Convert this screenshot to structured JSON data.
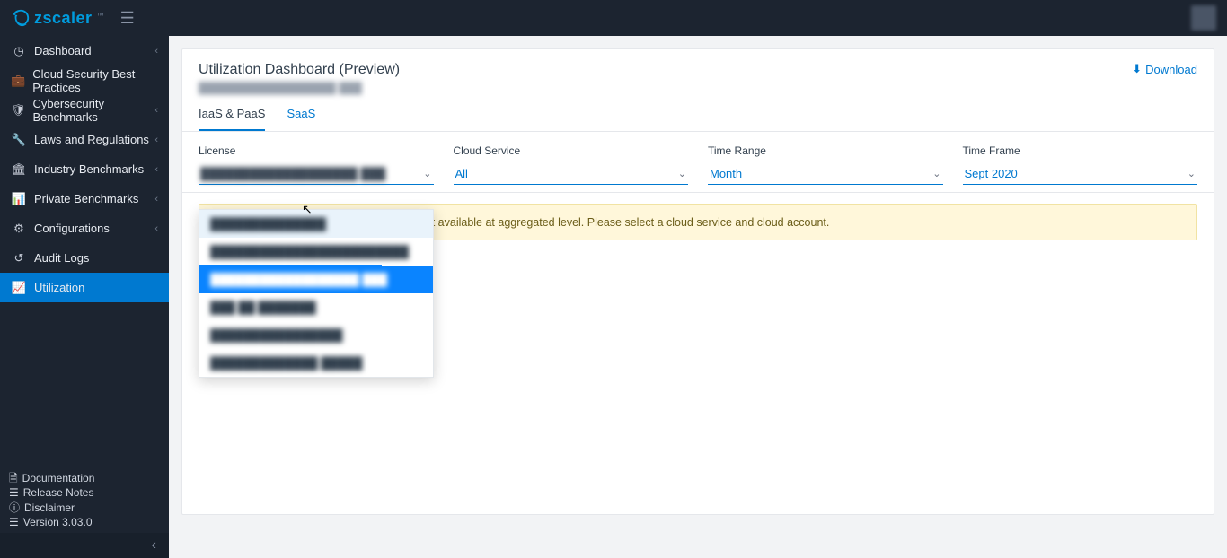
{
  "brand": {
    "name": "zscaler"
  },
  "sidebar": {
    "items": [
      {
        "label": "Dashboard",
        "icon": "gauge",
        "expandable": true
      },
      {
        "label": "Cloud Security Best Practices",
        "icon": "briefcase",
        "expandable": false
      },
      {
        "label": "Cybersecurity Benchmarks",
        "icon": "shield",
        "expandable": true
      },
      {
        "label": "Laws and Regulations",
        "icon": "wrench",
        "expandable": true
      },
      {
        "label": "Industry Benchmarks",
        "icon": "bank",
        "expandable": true
      },
      {
        "label": "Private Benchmarks",
        "icon": "bars",
        "expandable": true
      },
      {
        "label": "Configurations",
        "icon": "sliders",
        "expandable": true
      },
      {
        "label": "Audit Logs",
        "icon": "history",
        "expandable": false
      },
      {
        "label": "Utilization",
        "icon": "line-chart",
        "expandable": false
      }
    ],
    "footer": [
      {
        "label": "Documentation",
        "icon": "doc"
      },
      {
        "label": "Release Notes",
        "icon": "list"
      },
      {
        "label": "Disclaimer",
        "icon": "info"
      },
      {
        "label": "Version 3.03.0",
        "icon": "list"
      }
    ]
  },
  "page": {
    "title": "Utilization Dashboard (Preview)",
    "subtitle": "██████████████████  ███",
    "download": "Download"
  },
  "tabs": [
    {
      "label": "IaaS & PaaS",
      "active": true
    },
    {
      "label": "SaaS",
      "active": false
    }
  ],
  "filters": {
    "license": {
      "label": "License",
      "value": "███████████████████ ███"
    },
    "cloud_service": {
      "label": "Cloud Service",
      "value": "All"
    },
    "time_range": {
      "label": "Time Range",
      "value": "Month"
    },
    "time_frame": {
      "label": "Time Frame",
      "value": "Sept 2020"
    }
  },
  "license_options": [
    {
      "label": "██████████████",
      "state": "hover"
    },
    {
      "label": "████████████████████████",
      "state": "line"
    },
    {
      "label": "██████████████████ ███",
      "state": "selected"
    },
    {
      "label": "███ ██ ███████",
      "state": ""
    },
    {
      "label": "████████████████",
      "state": ""
    },
    {
      "label": "█████████████ █████",
      "state": ""
    }
  ],
  "warning": "Workload based utilization details are not available at aggregated level. Please select a cloud service and cloud account."
}
